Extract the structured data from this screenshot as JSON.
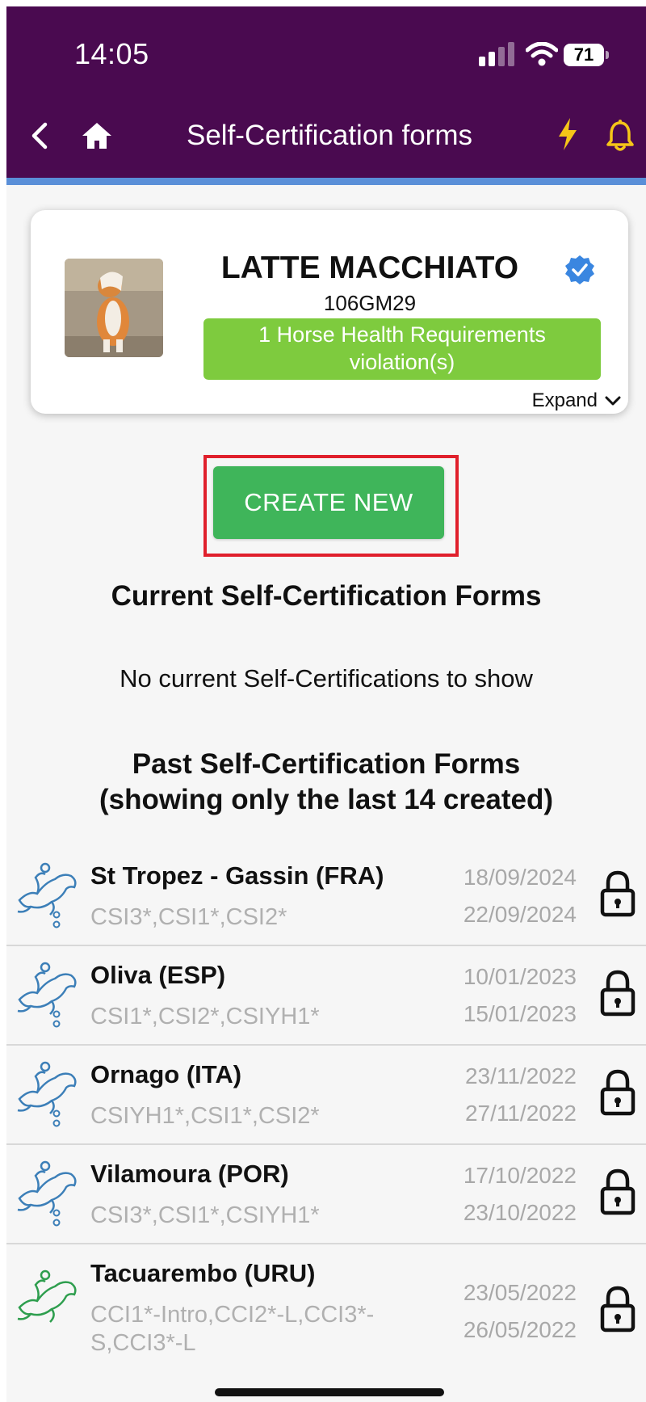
{
  "status_bar": {
    "time": "14:05",
    "battery": "71"
  },
  "header": {
    "title": "Self-Certification forms"
  },
  "horse": {
    "name": "LATTE MACCHIATO",
    "id": "106GM29",
    "violation": "1 Horse Health Requirements violation(s)",
    "expand_label": "Expand"
  },
  "actions": {
    "create_new": "CREATE NEW"
  },
  "current": {
    "title": "Current Self-Certification Forms",
    "empty_message": "No current Self-Certifications to show"
  },
  "past": {
    "title_line1": "Past Self-Certification Forms",
    "title_line2": "(showing only the last 14 created)",
    "events": [
      {
        "name": "St Tropez - Gassin (FRA)",
        "classes": "CSI3*,CSI1*,CSI2*",
        "start": "18/09/2024",
        "end": "22/09/2024",
        "discipline": "jumping"
      },
      {
        "name": "Oliva (ESP)",
        "classes": "CSI1*,CSI2*,CSIYH1*",
        "start": "10/01/2023",
        "end": "15/01/2023",
        "discipline": "jumping"
      },
      {
        "name": "Ornago (ITA)",
        "classes": "CSIYH1*,CSI1*,CSI2*",
        "start": "23/11/2022",
        "end": "27/11/2022",
        "discipline": "jumping"
      },
      {
        "name": "Vilamoura (POR)",
        "classes": "CSI3*,CSI1*,CSIYH1*",
        "start": "17/10/2022",
        "end": "23/10/2022",
        "discipline": "jumping"
      },
      {
        "name": "Tacuarembo (URU)",
        "classes": "CCI1*-Intro,CCI2*-L,CCI3*-S,CCI3*-L",
        "start": "23/05/2022",
        "end": "26/05/2022",
        "discipline": "eventing"
      }
    ]
  },
  "colors": {
    "header_bg": "#4a0a50",
    "accent_bar": "#5a8fd8",
    "violation_bg": "#7ecb3e",
    "button_bg": "#3fb55a",
    "highlight": "#e0202c",
    "jumping_icon": "#3c7fb8",
    "eventing_icon": "#2e9e4e",
    "header_icons": "#f5c518"
  }
}
